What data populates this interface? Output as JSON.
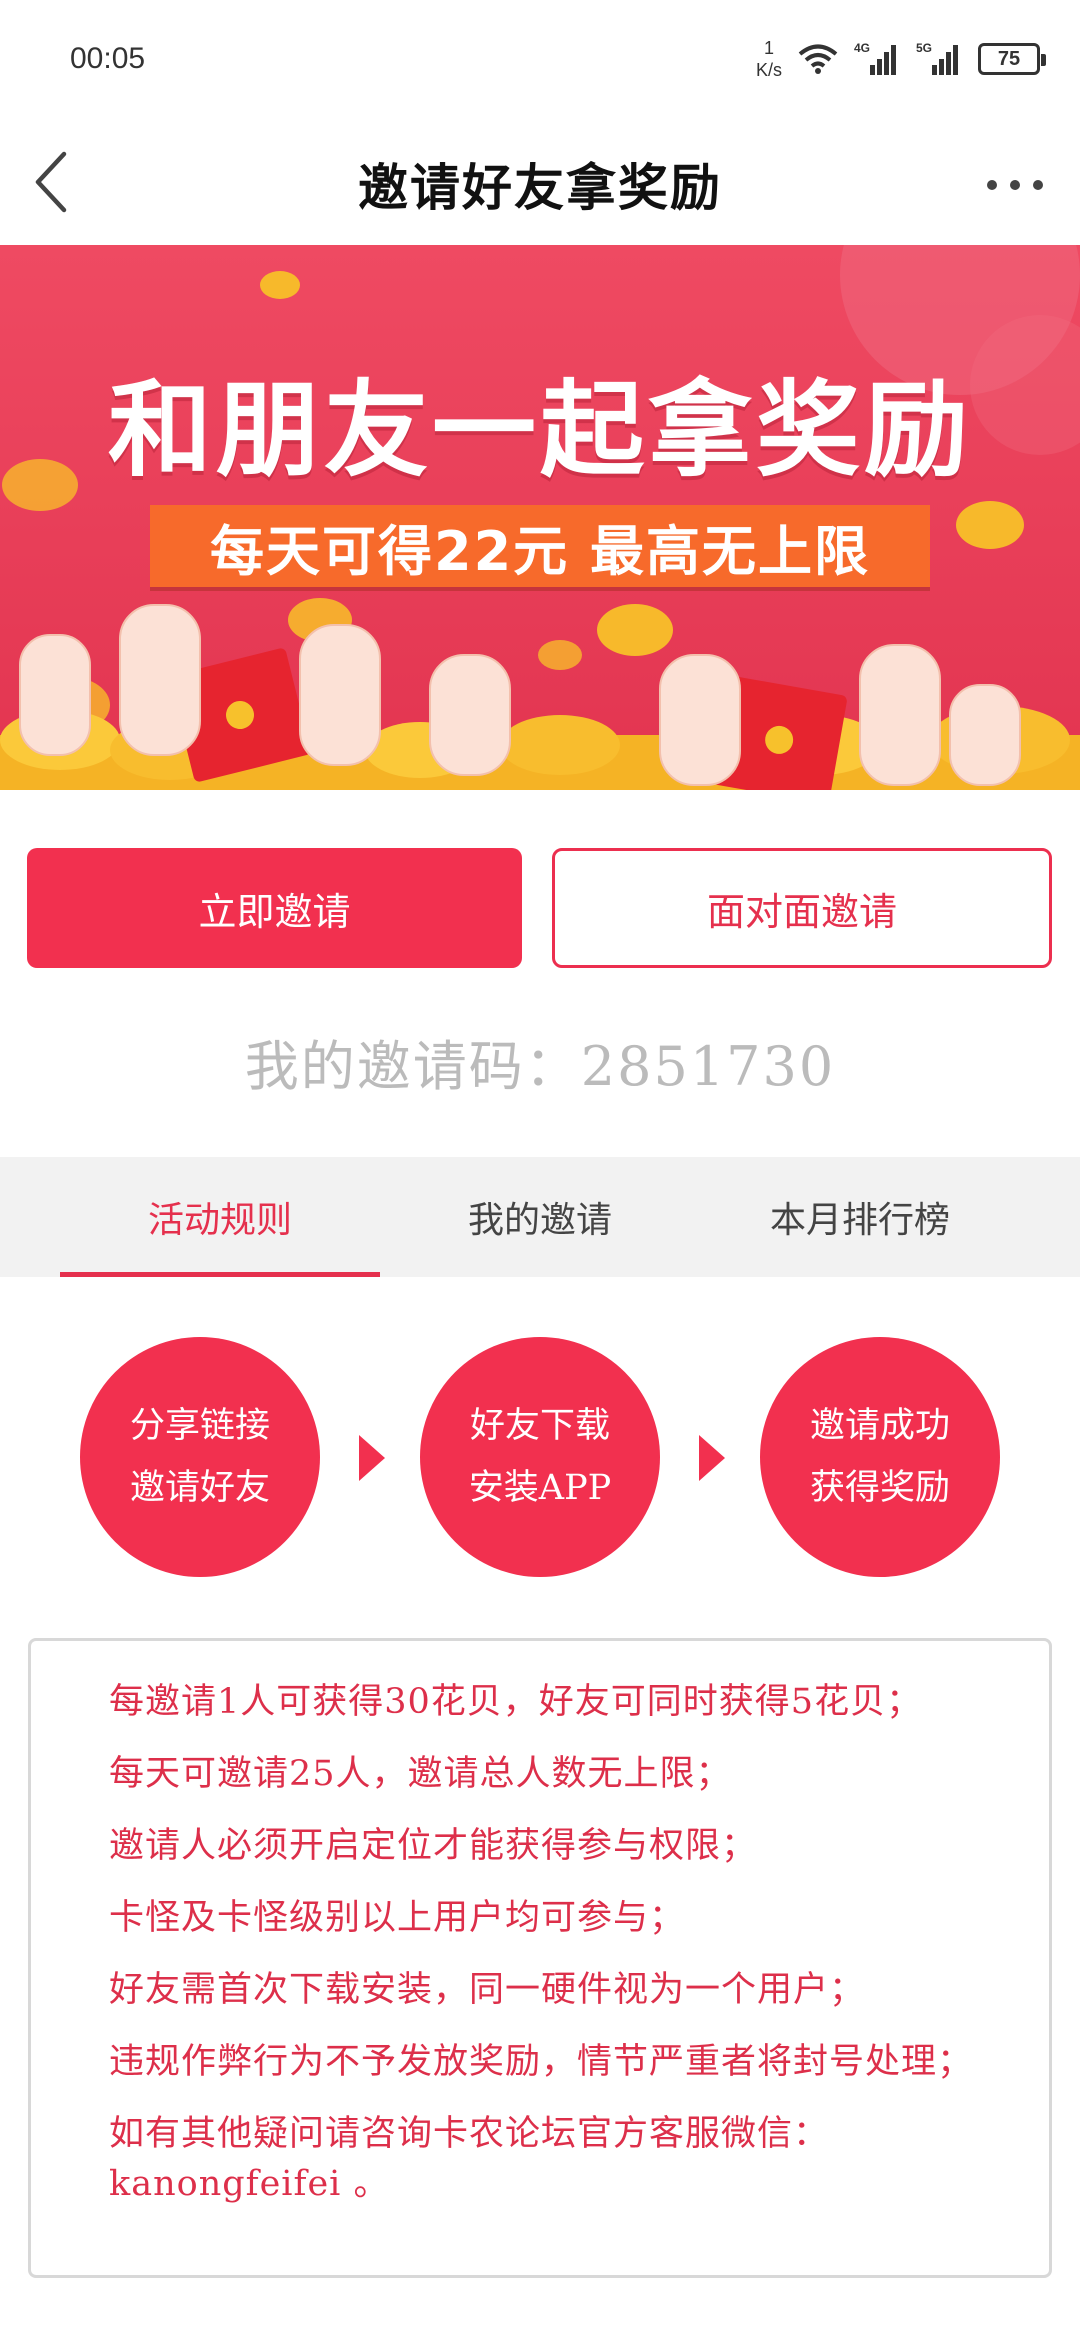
{
  "status_bar": {
    "time": "00:05",
    "net_speed_value": "1",
    "net_speed_unit": "K/s",
    "network_1": "4G",
    "network_2": "5G",
    "battery": "75"
  },
  "header": {
    "title": "邀请好友拿奖励"
  },
  "banner": {
    "title": "和朋友一起拿奖励",
    "subtitle": "每天可得22元 最高无上限"
  },
  "buttons": {
    "invite_now": "立即邀请",
    "face_to_face": "面对面邀请"
  },
  "invite_code": {
    "label": "我的邀请码：",
    "value": "2851730"
  },
  "tabs": [
    {
      "label": "活动规则",
      "active": true
    },
    {
      "label": "我的邀请",
      "active": false
    },
    {
      "label": "本月排行榜",
      "active": false
    }
  ],
  "steps": [
    {
      "line1": "分享链接",
      "line2": "邀请好友"
    },
    {
      "line1": "好友下载",
      "line2": "安装APP"
    },
    {
      "line1": "邀请成功",
      "line2": "获得奖励"
    }
  ],
  "rules": [
    "每邀请1人可获得30花贝，好友可同时获得5花贝；",
    "每天可邀请25人，邀请总人数无上限；",
    "邀请人必须开启定位才能获得参与权限；",
    "卡怪及卡怪级别以上用户均可参与；",
    "好友需首次下载安装，同一硬件视为一个用户；",
    "违规作弊行为不予发放奖励，情节严重者将封号处理；",
    "如有其他疑问请咨询卡农论坛官方客服微信：kanongfeifei 。"
  ],
  "colors": {
    "accent": "#f2304f",
    "rule_text": "#dd2f4a",
    "banner_bg": "#ea3b55",
    "ribbon": "#f76a2b",
    "coin": "#f7b92b"
  }
}
